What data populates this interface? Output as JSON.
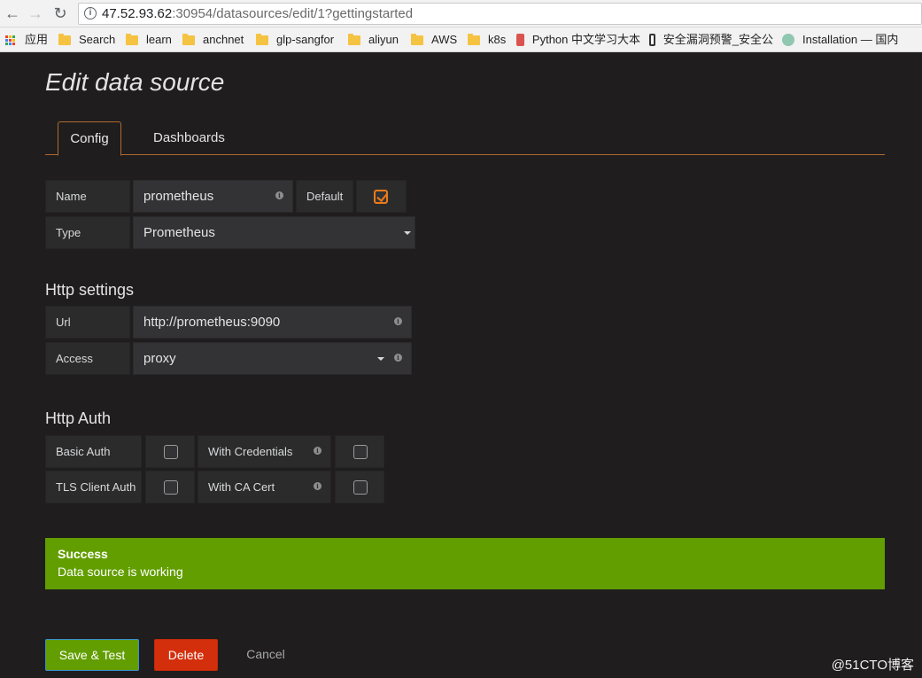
{
  "browser": {
    "url_host": "47.52.93.62",
    "url_rest": ":30954/datasources/edit/1?gettingstarted",
    "bookmarks": [
      {
        "label": "应用"
      },
      {
        "label": "Search"
      },
      {
        "label": "learn"
      },
      {
        "label": "anchnet"
      },
      {
        "label": "glp-sangfor"
      },
      {
        "label": "aliyun"
      },
      {
        "label": "AWS"
      },
      {
        "label": "k8s"
      },
      {
        "label": "Python 中文学习大本"
      },
      {
        "label": "安全漏洞预警_安全公"
      },
      {
        "label": "Installation — 国内"
      }
    ]
  },
  "page": {
    "title": "Edit data source",
    "tabs": [
      {
        "label": "Config",
        "active": true
      },
      {
        "label": "Dashboards",
        "active": false
      }
    ],
    "basic": {
      "name_label": "Name",
      "name_value": "prometheus",
      "default_label": "Default",
      "default_checked": true,
      "type_label": "Type",
      "type_value": "Prometheus"
    },
    "http_settings": {
      "heading": "Http settings",
      "url_label": "Url",
      "url_value": "http://prometheus:9090",
      "access_label": "Access",
      "access_value": "proxy"
    },
    "http_auth": {
      "heading": "Http Auth",
      "basic_auth_label": "Basic Auth",
      "with_credentials_label": "With Credentials",
      "tls_client_auth_label": "TLS Client Auth",
      "with_ca_cert_label": "With CA Cert"
    },
    "alert": {
      "title": "Success",
      "message": "Data source is working",
      "color": "#629e00"
    },
    "buttons": {
      "save_label": "Save & Test",
      "delete_label": "Delete",
      "cancel_label": "Cancel"
    },
    "watermark": "@51CTO博客",
    "colors": {
      "accent": "#eb7b18",
      "success": "#629e00",
      "danger": "#d42f0c"
    }
  }
}
